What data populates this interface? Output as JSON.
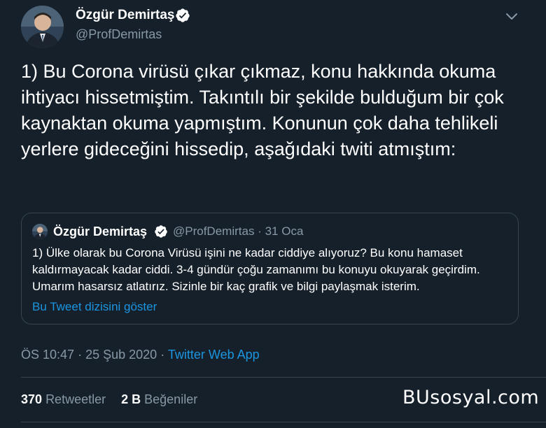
{
  "author": {
    "name": "Özgür Demirtaş",
    "handle": "@ProfDemirtas",
    "verified": true
  },
  "tweet": {
    "text": "1) Bu Corona virüsü çıkar çıkmaz, konu hakkında okuma ihtiyacı hissetmiştim. Takıntılı bir şekilde bulduğum bir çok kaynaktan okuma yapmıştım. Konunun çok daha tehlikeli yerlere gideceğini hissedip, aşağıdaki twiti atmıştım:"
  },
  "quoted_tweet": {
    "name": "Özgür Demirtaş",
    "handle": "@ProfDemirtas",
    "separator": "·",
    "date": "31 Oca",
    "text": "1) Ülke olarak bu Corona Virüsü işini ne kadar ciddiye alıyoruz? Bu konu hamaset kaldırmayacak kadar ciddi. 3-4 gündür çoğu zamanımı bu konuyu okuyarak geçirdim. Umarım hasarsız atlatırız. Sizinle bir kaç grafik ve bilgi paylaşmak isterim.",
    "show_thread": "Bu Tweet dizisini göster"
  },
  "meta": {
    "time": "ÖS 10:47",
    "date": "25 Şub 2020",
    "separator": "·",
    "source": "Twitter Web App"
  },
  "stats": {
    "retweets_count": "370",
    "retweets_label": "Retweetler",
    "likes_count": "2 B",
    "likes_label": "Beğeniler"
  },
  "watermark": "BUsosyal.com",
  "icons": {
    "verified": "verified-badge-icon",
    "menu": "chevron-down-icon"
  },
  "colors": {
    "background": "#15202b",
    "accent": "#1b95e0",
    "secondary_text": "#8899a6",
    "border": "#38444d"
  }
}
